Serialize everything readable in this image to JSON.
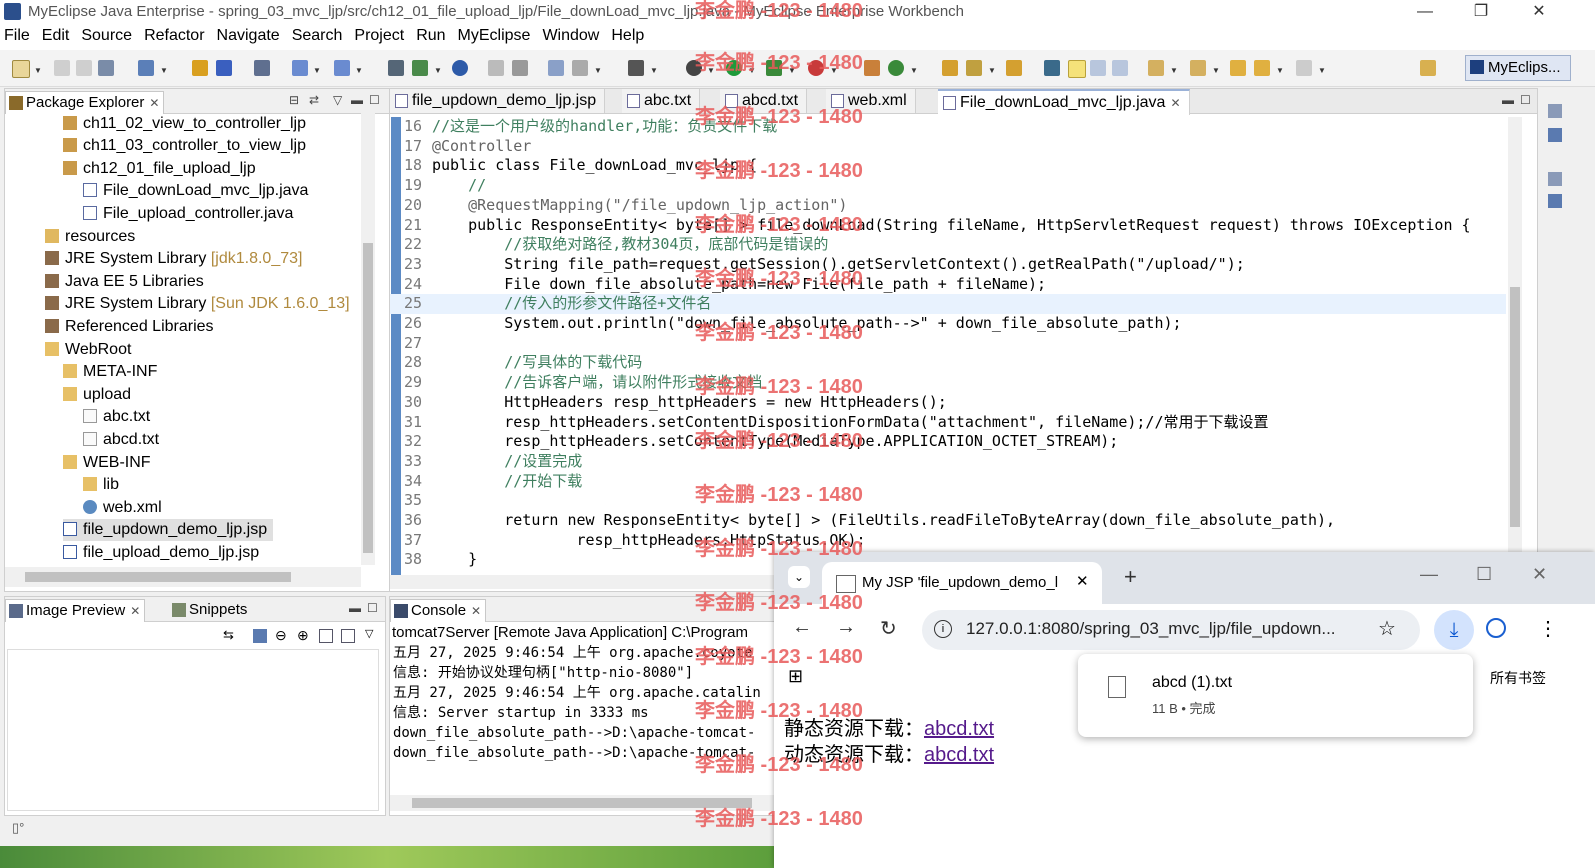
{
  "window": {
    "title": "MyEclipse Java Enterprise - spring_03_mvc_ljp/src/ch12_01_file_upload_ljp/File_downLoad_mvc_ljp.java - MyEclipse Enterprise Workbench",
    "minimize": "—",
    "restore": "❐",
    "close": "✕"
  },
  "menu": [
    "File",
    "Edit",
    "Source",
    "Refactor",
    "Navigate",
    "Search",
    "Project",
    "Run",
    "MyEclipse",
    "Window",
    "Help"
  ],
  "perspective": "MyEclips...",
  "package_explorer": {
    "title": "Package Explorer",
    "items": [
      {
        "label": "ch11_02_view_to_controller_ljp",
        "deco": ""
      },
      {
        "label": "ch11_03_controller_to_view_ljp",
        "deco": ""
      },
      {
        "label": "ch12_01_file_upload_ljp",
        "deco": ""
      },
      {
        "label": "File_downLoad_mvc_ljp.java",
        "deco": ""
      },
      {
        "label": "File_upload_controller.java",
        "deco": ""
      },
      {
        "label": "resources",
        "deco": ""
      },
      {
        "label": "JRE System Library",
        "deco": "[jdk1.8.0_73]"
      },
      {
        "label": "Java EE 5 Libraries",
        "deco": ""
      },
      {
        "label": "JRE System Library",
        "deco": "[Sun JDK 1.6.0_13]"
      },
      {
        "label": "Referenced Libraries",
        "deco": ""
      },
      {
        "label": "WebRoot",
        "deco": ""
      },
      {
        "label": "META-INF",
        "deco": ""
      },
      {
        "label": "upload",
        "deco": ""
      },
      {
        "label": "abc.txt",
        "deco": ""
      },
      {
        "label": "abcd.txt",
        "deco": ""
      },
      {
        "label": "WEB-INF",
        "deco": ""
      },
      {
        "label": "lib",
        "deco": ""
      },
      {
        "label": "web.xml",
        "deco": ""
      },
      {
        "label": "file_updown_demo_ljp.jsp",
        "deco": ""
      },
      {
        "label": "file_upload_demo_ljp.jsp",
        "deco": ""
      }
    ]
  },
  "editor": {
    "tabs": [
      "file_updown_demo_ljp.jsp",
      "abc.txt",
      "abcd.txt",
      "web.xml",
      "File_downLoad_mvc_ljp.java"
    ],
    "active_tab": "File_downLoad_mvc_ljp.java",
    "lines": [
      {
        "n": "16",
        "text": "//这是一个用户级的handler,功能：负责文件下载"
      },
      {
        "n": "17",
        "text": "@Controller"
      },
      {
        "n": "18",
        "text": "public class File_downLoad_mvc_ljp {"
      },
      {
        "n": "19",
        "text": "    //"
      },
      {
        "n": "20",
        "text": "    @RequestMapping(\"/file_updown_ljp_action\")"
      },
      {
        "n": "21",
        "text": "    public ResponseEntity< byte[] > file_downLoad(String fileName, HttpServletRequest request) throws IOException {"
      },
      {
        "n": "22",
        "text": "        //获取绝对路径,教材304页，底部代码是错误的"
      },
      {
        "n": "23",
        "text": "        String file_path=request.getSession().getServletContext().getRealPath(\"/upload/\");"
      },
      {
        "n": "24",
        "text": "        File down_file_absolute_path=new File(file_path + fileName);"
      },
      {
        "n": "25",
        "text": "        //传入的形参文件路径+文件名"
      },
      {
        "n": "26",
        "text": "        System.out.println(\"down_file_absolute_path-->\" + down_file_absolute_path);"
      },
      {
        "n": "27",
        "text": ""
      },
      {
        "n": "28",
        "text": "        //写具体的下载代码"
      },
      {
        "n": "29",
        "text": "        //告诉客户端，请以附件形式接收文档"
      },
      {
        "n": "30",
        "text": "        HttpHeaders resp_httpHeaders = new HttpHeaders();"
      },
      {
        "n": "31",
        "text": "        resp_httpHeaders.setContentDispositionFormData(\"attachment\", fileName);//常用于下载设置"
      },
      {
        "n": "32",
        "text": "        resp_httpHeaders.setContentType(MediaType.APPLICATION_OCTET_STREAM);"
      },
      {
        "n": "33",
        "text": "        //设置完成"
      },
      {
        "n": "34",
        "text": "        //开始下载"
      },
      {
        "n": "35",
        "text": ""
      },
      {
        "n": "36",
        "text": "        return new ResponseEntity< byte[] > (FileUtils.readFileToByteArray(down_file_absolute_path),"
      },
      {
        "n": "37",
        "text": "                resp_httpHeaders,HttpStatus.OK);"
      },
      {
        "n": "38",
        "text": "    }"
      }
    ]
  },
  "image_preview": {
    "title": "Image Preview",
    "snippets_tab": "Snippets"
  },
  "console": {
    "title": "Console",
    "header": "tomcat7Server [Remote Java Application] C:\\Program",
    "lines": [
      "五月 27, 2025 9:46:54 上午 org.apache.coyote",
      "信息: 开始协议处理句柄[\"http-nio-8080\"]",
      "五月 27, 2025 9:46:54 上午 org.apache.catalin",
      "信息: Server startup in 3333 ms",
      "down_file_absolute_path-->D:\\apache-tomcat-",
      "down_file_absolute_path-->D:\\apache-tomcat-"
    ]
  },
  "browser": {
    "tab_title": "My JSP 'file_updown_demo_l",
    "url": "127.0.0.1:8080/spring_03_mvc_ljp/file_updown...",
    "bookmarks": "所有书签",
    "download": {
      "filename": "abcd (1).txt",
      "status": "11 B • 完成"
    },
    "static_label": "静态资源下载：",
    "dynamic_label": "动态资源下载：",
    "link_text": "abcd.txt"
  },
  "watermark": "李金鹏 -123 - 1480"
}
